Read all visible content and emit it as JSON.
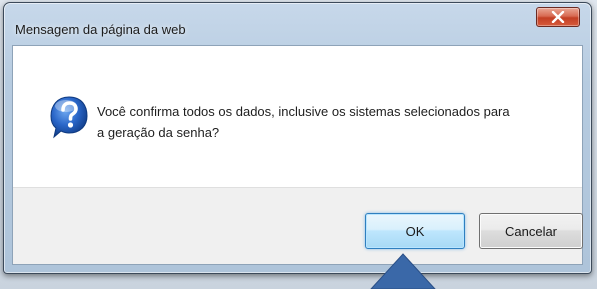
{
  "dialog": {
    "title": "Mensagem da página da web",
    "message_line1": "Você confirma todos os dados, inclusive os sistemas selecionados para",
    "message_line2": "a geração da senha?",
    "ok_label": "OK",
    "cancel_label": "Cancelar"
  },
  "icons": {
    "close": "close-icon",
    "question": "question-icon",
    "pointer": "arrow-up-icon"
  },
  "colors": {
    "titlebar": "#b6cbe0",
    "close_button": "#c33f24",
    "question_icon": "#1f5fbf",
    "pointer_arrow": "#3a68a8",
    "ok_border": "#2f7fbf"
  }
}
